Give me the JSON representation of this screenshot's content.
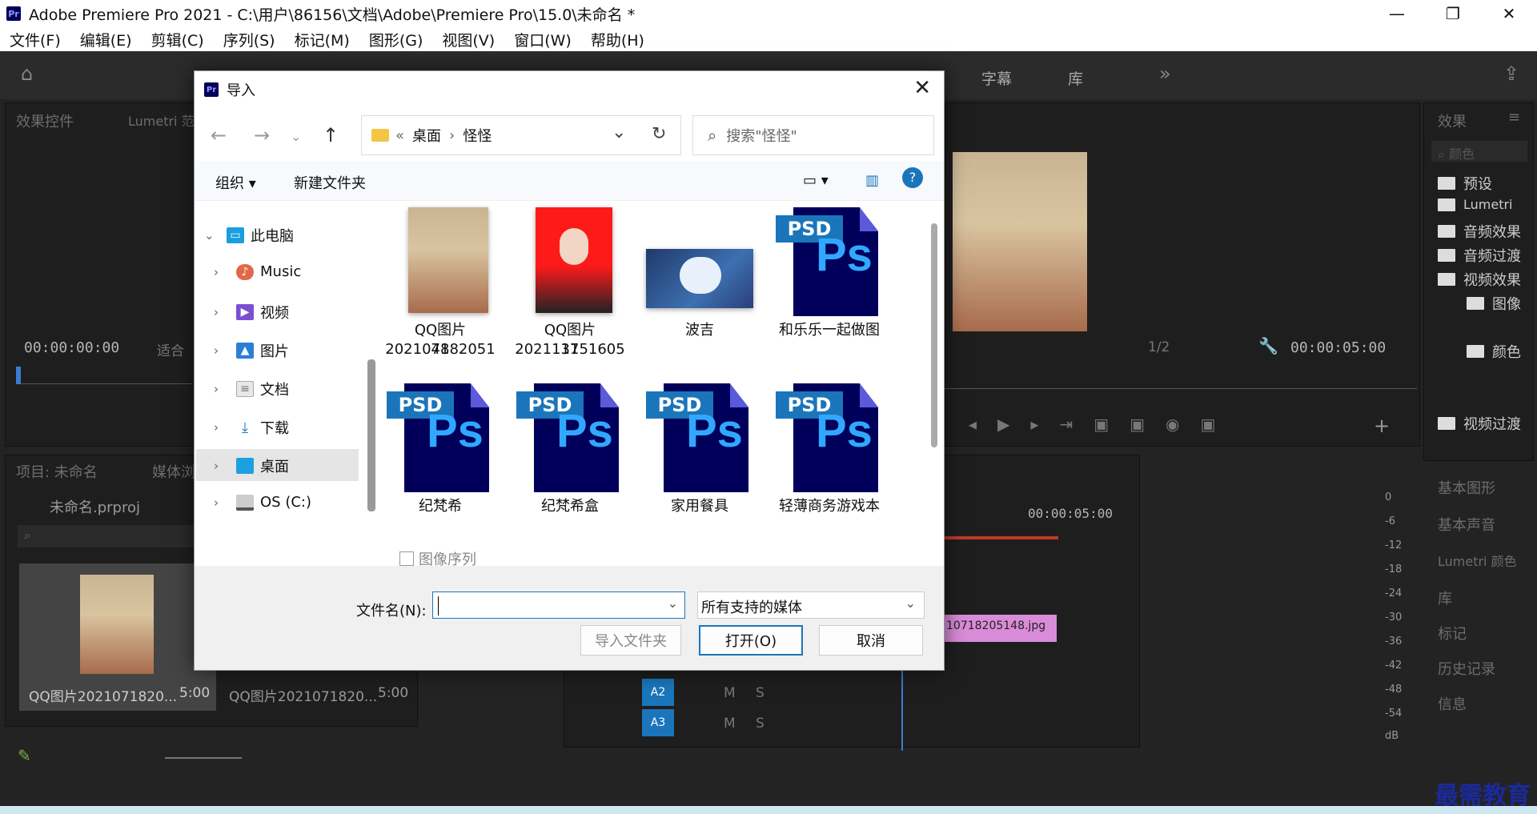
{
  "app": {
    "title": "Adobe Premiere Pro 2021 - C:\\用户\\86156\\文档\\Adobe\\Premiere Pro\\15.0\\未命名 *",
    "logo": "Pr"
  },
  "menu": [
    "文件(F)",
    "编辑(E)",
    "剪辑(C)",
    "序列(S)",
    "标记(M)",
    "图形(G)",
    "视图(V)",
    "窗口(W)",
    "帮助(H)"
  ],
  "workspace_tabs": [
    "字幕",
    "库"
  ],
  "panels": {
    "effect_controls": "效果控件",
    "lumetri": "Lumetri 范",
    "effects": "效果",
    "effects_search": "颜色",
    "project_title": "项目: 未命名",
    "media_browser": "媒体浏",
    "project_file": "未命名.prproj",
    "essential_graphics": "基本图形",
    "essential_sound": "基本声音",
    "lumetri_color": "Lumetri 颜色",
    "libraries": "库",
    "markers": "标记",
    "history": "历史记录",
    "info": "信息"
  },
  "timecodes": {
    "source": "00:00:00:00",
    "fit": "适合",
    "program_end": "00:00:05:00",
    "program_ratio": "1/2",
    "timeline_ruler": "00:00:05:00"
  },
  "effects_tree": [
    "预设",
    "Lumetri",
    "音频效果",
    "音频过渡",
    "视频效果",
    "图像",
    "颜色",
    "视频过渡"
  ],
  "project_items": [
    {
      "name": "QQ图片2021071820...",
      "duration": "5:00"
    },
    {
      "name": "QQ图片2021071820...",
      "duration": "5:00"
    }
  ],
  "timeline": {
    "clip": "10718205148.jpg",
    "tracks": [
      "A2",
      "A3"
    ],
    "track_m": "M",
    "track_s": "S",
    "meter_labels": [
      "0",
      "-6",
      "-12",
      "-18",
      "-24",
      "-30",
      "-36",
      "-42",
      "-48",
      "-54",
      "dB"
    ]
  },
  "watermark": "最需教育",
  "dialog": {
    "title": "导入",
    "path": {
      "prefix": "«",
      "crumbs": [
        "桌面",
        "怪怪"
      ]
    },
    "search_placeholder": "搜索\"怪怪\"",
    "toolbar": {
      "organize": "组织 ▾",
      "new_folder": "新建文件夹"
    },
    "tree": [
      {
        "label": "此电脑",
        "icon": "computer-icon",
        "color": "#1b9de2",
        "level": 0,
        "expanded": true
      },
      {
        "label": "Music",
        "icon": "music-icon",
        "color": "#e2684a",
        "level": 1
      },
      {
        "label": "视频",
        "icon": "video-icon",
        "color": "#7b4fd1",
        "level": 1
      },
      {
        "label": "图片",
        "icon": "picture-icon",
        "color": "#2c7fd6",
        "level": 1
      },
      {
        "label": "文档",
        "icon": "document-icon",
        "color": "#8a8a8a",
        "level": 1
      },
      {
        "label": "下载",
        "icon": "download-icon",
        "color": "#1b75bb",
        "level": 1
      },
      {
        "label": "桌面",
        "icon": "desktop-icon",
        "color": "#1ba0e0",
        "level": 1,
        "selected": true
      },
      {
        "label": "OS (C:)",
        "icon": "drive-icon",
        "color": "#555555",
        "level": 1
      }
    ],
    "files": [
      {
        "name": "QQ图片202107182051",
        "name2": "48",
        "kind": "photo"
      },
      {
        "name": "QQ图片202111151605",
        "name2": "37",
        "kind": "idphoto"
      },
      {
        "name": "波吉",
        "kind": "cartoon"
      },
      {
        "name": "和乐乐一起做图",
        "kind": "psd"
      },
      {
        "name": "纪梵希",
        "kind": "psd"
      },
      {
        "name": "纪梵希盒",
        "kind": "psd"
      },
      {
        "name": "家用餐具",
        "kind": "psd"
      },
      {
        "name": "轻薄商务游戏本",
        "kind": "psd"
      }
    ],
    "psd_tag": "PSD",
    "ps_mark": "Ps",
    "image_sequence": "图像序列",
    "filename_label": "文件名(N):",
    "filename_value": "",
    "file_type": "所有支持的媒体",
    "buttons": {
      "import_folder": "导入文件夹",
      "open": "打开(O)",
      "cancel": "取消"
    }
  }
}
